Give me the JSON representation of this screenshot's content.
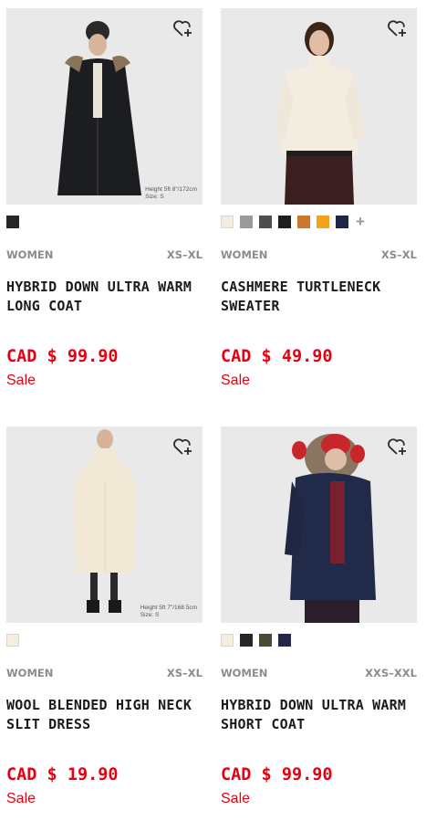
{
  "products": [
    {
      "image_caption": [
        "Height 5ft 8\"/172cm",
        "Size: S"
      ],
      "colors": [
        "#262626"
      ],
      "more_colors": "",
      "gender": "WOMEN",
      "size_range": "XS–XL",
      "name": "HYBRID DOWN ULTRA WARM LONG COAT",
      "price": "CAD $ 99.90",
      "sale_label": "Sale"
    },
    {
      "image_caption": [
        "",
        ""
      ],
      "colors": [
        "#f3ece1",
        "#9a9a9a",
        "#4e4e4e",
        "#1e1e1e",
        "#c9782e",
        "#f1a31c",
        "#1f2546"
      ],
      "more_colors": "+",
      "gender": "WOMEN",
      "size_range": "XS–XL",
      "name": "CASHMERE TURTLENECK SWEATER",
      "price": "CAD $ 49.90",
      "sale_label": "Sale"
    },
    {
      "image_caption": [
        "Height 5ft 7\"/168.5cm",
        "Size: S"
      ],
      "colors": [
        "#f5eedf"
      ],
      "more_colors": "",
      "gender": "WOMEN",
      "size_range": "XS–XL",
      "name": "WOOL BLENDED HIGH NECK SLIT DRESS",
      "price": "CAD $ 19.90",
      "sale_label": "Sale"
    },
    {
      "image_caption": [
        "",
        ""
      ],
      "colors": [
        "#f5eedf",
        "#262626",
        "#4d4a33",
        "#23264a"
      ],
      "more_colors": "",
      "gender": "WOMEN",
      "size_range": "XXS–XXL",
      "name": "HYBRID DOWN ULTRA WARM SHORT COAT",
      "price": "CAD $ 99.90",
      "sale_label": "Sale"
    }
  ],
  "icons": {
    "favorite": "heart-plus-icon",
    "more_colors": "plus-icon"
  },
  "theme": {
    "price_color": "#e60012",
    "meta_color": "#8c8c8c",
    "photo_background": "#e8e8e8"
  }
}
